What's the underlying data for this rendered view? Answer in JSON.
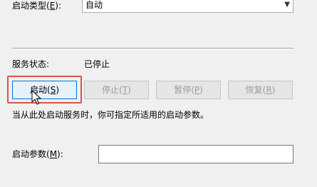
{
  "startup_type": {
    "label_pre": "启动类型(",
    "label_key": "E",
    "label_post": "):",
    "value": "自动"
  },
  "service_status": {
    "label": "服务状态:",
    "value": "已停止"
  },
  "buttons": {
    "start": {
      "pre": "启动(",
      "key": "S",
      "post": ")"
    },
    "stop": {
      "pre": "停止(",
      "key": "T",
      "post": ")"
    },
    "pause": {
      "pre": "暂停(",
      "key": "P",
      "post": ")"
    },
    "resume": {
      "pre": "恢复(",
      "key": "R",
      "post": ")"
    }
  },
  "hint": "当从此处启动服务时，你可指定所适用的启动参数。",
  "start_params": {
    "label_pre": "启动参数(",
    "label_key": "M",
    "label_post": "):",
    "value": ""
  },
  "colors": {
    "highlight": "#d9534f",
    "focus_border": "#0078d7"
  }
}
